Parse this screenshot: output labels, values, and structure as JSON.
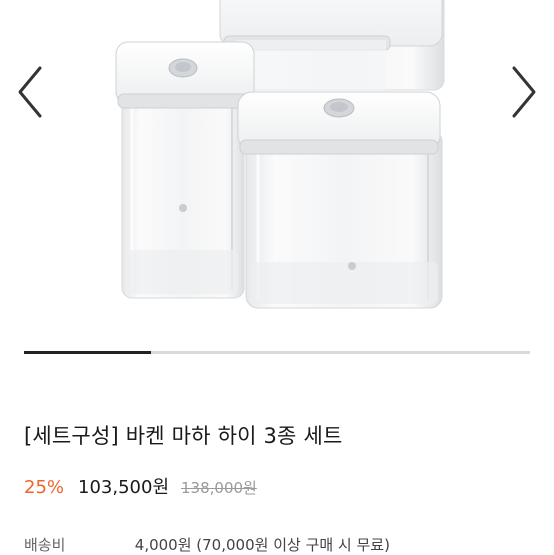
{
  "gallery": {
    "image_alt": "airtight containers set",
    "prev_icon": "chevron-left-icon",
    "next_icon": "chevron-right-icon",
    "progress": 0.25
  },
  "product": {
    "title": "[세트구성] 바켄 마하 하이 3종 세트",
    "discount": "25%",
    "price": "103,500원",
    "original_price": "138,000원"
  },
  "shipping": {
    "label": "배송비",
    "value": "4,000원 (70,000원 이상 구매 시 무료)"
  },
  "colors": {
    "discount": "#f0642a",
    "progress": "#222222"
  }
}
